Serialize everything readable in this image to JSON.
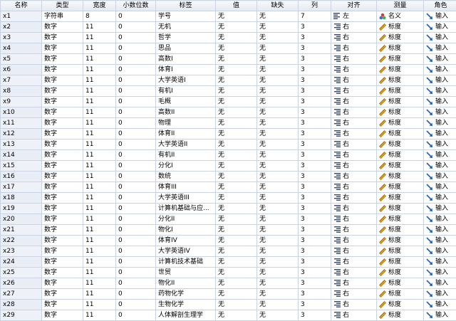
{
  "columns": [
    "名称",
    "类型",
    "宽度",
    "小数位数",
    "标签",
    "值",
    "缺失",
    "列",
    "对齐",
    "测量",
    "角色"
  ],
  "rows": [
    {
      "name": "x1",
      "type": "字符串",
      "width": "8",
      "decimals": "0",
      "label": "学号",
      "values": "无",
      "missing": "无",
      "columns": "7",
      "align": "左",
      "measure": "名义",
      "role": "输入",
      "align_icon": "align-left-icon",
      "measure_icon": "nominal-icon",
      "role_icon": "input-arrow-icon"
    },
    {
      "name": "x2",
      "type": "数字",
      "width": "11",
      "decimals": "0",
      "label": "无机",
      "values": "无",
      "missing": "无",
      "columns": "3",
      "align": "右",
      "measure": "标度",
      "role": "输入",
      "align_icon": "align-right-icon",
      "measure_icon": "ruler-icon",
      "role_icon": "input-arrow-icon"
    },
    {
      "name": "x3",
      "type": "数字",
      "width": "11",
      "decimals": "0",
      "label": "哲学",
      "values": "无",
      "missing": "无",
      "columns": "3",
      "align": "右",
      "measure": "标度",
      "role": "输入",
      "align_icon": "align-right-icon",
      "measure_icon": "ruler-icon",
      "role_icon": "input-arrow-icon"
    },
    {
      "name": "x4",
      "type": "数字",
      "width": "11",
      "decimals": "0",
      "label": "思品",
      "values": "无",
      "missing": "无",
      "columns": "3",
      "align": "右",
      "measure": "标度",
      "role": "输入",
      "align_icon": "align-right-icon",
      "measure_icon": "ruler-icon",
      "role_icon": "input-arrow-icon"
    },
    {
      "name": "x5",
      "type": "数字",
      "width": "11",
      "decimals": "0",
      "label": "高数I",
      "values": "无",
      "missing": "无",
      "columns": "3",
      "align": "右",
      "measure": "标度",
      "role": "输入",
      "align_icon": "align-right-icon",
      "measure_icon": "ruler-icon",
      "role_icon": "input-arrow-icon"
    },
    {
      "name": "x6",
      "type": "数字",
      "width": "11",
      "decimals": "0",
      "label": "体育I",
      "values": "无",
      "missing": "无",
      "columns": "3",
      "align": "右",
      "measure": "标度",
      "role": "输入",
      "align_icon": "align-right-icon",
      "measure_icon": "ruler-icon",
      "role_icon": "input-arrow-icon"
    },
    {
      "name": "x7",
      "type": "数字",
      "width": "11",
      "decimals": "0",
      "label": "大学英语I",
      "values": "无",
      "missing": "无",
      "columns": "3",
      "align": "右",
      "measure": "标度",
      "role": "输入",
      "align_icon": "align-right-icon",
      "measure_icon": "ruler-icon",
      "role_icon": "input-arrow-icon"
    },
    {
      "name": "x8",
      "type": "数字",
      "width": "11",
      "decimals": "0",
      "label": "有机I",
      "values": "无",
      "missing": "无",
      "columns": "3",
      "align": "右",
      "measure": "标度",
      "role": "输入",
      "align_icon": "align-right-icon",
      "measure_icon": "ruler-icon",
      "role_icon": "input-arrow-icon"
    },
    {
      "name": "x9",
      "type": "数字",
      "width": "11",
      "decimals": "0",
      "label": "毛概",
      "values": "无",
      "missing": "无",
      "columns": "3",
      "align": "右",
      "measure": "标度",
      "role": "输入",
      "align_icon": "align-right-icon",
      "measure_icon": "ruler-icon",
      "role_icon": "input-arrow-icon"
    },
    {
      "name": "x10",
      "type": "数字",
      "width": "11",
      "decimals": "0",
      "label": "高数II",
      "values": "无",
      "missing": "无",
      "columns": "3",
      "align": "右",
      "measure": "标度",
      "role": "输入",
      "align_icon": "align-right-icon",
      "measure_icon": "ruler-icon",
      "role_icon": "input-arrow-icon"
    },
    {
      "name": "x11",
      "type": "数字",
      "width": "11",
      "decimals": "0",
      "label": "物理",
      "values": "无",
      "missing": "无",
      "columns": "3",
      "align": "右",
      "measure": "标度",
      "role": "输入",
      "align_icon": "align-right-icon",
      "measure_icon": "ruler-icon",
      "role_icon": "input-arrow-icon"
    },
    {
      "name": "x12",
      "type": "数字",
      "width": "11",
      "decimals": "0",
      "label": "体育II",
      "values": "无",
      "missing": "无",
      "columns": "3",
      "align": "右",
      "measure": "标度",
      "role": "输入",
      "align_icon": "align-right-icon",
      "measure_icon": "ruler-icon",
      "role_icon": "input-arrow-icon"
    },
    {
      "name": "x13",
      "type": "数字",
      "width": "11",
      "decimals": "0",
      "label": "大学英语II",
      "values": "无",
      "missing": "无",
      "columns": "3",
      "align": "右",
      "measure": "标度",
      "role": "输入",
      "align_icon": "align-right-icon",
      "measure_icon": "ruler-icon",
      "role_icon": "input-arrow-icon"
    },
    {
      "name": "x14",
      "type": "数字",
      "width": "11",
      "decimals": "0",
      "label": "有机II",
      "values": "无",
      "missing": "无",
      "columns": "3",
      "align": "右",
      "measure": "标度",
      "role": "输入",
      "align_icon": "align-right-icon",
      "measure_icon": "ruler-icon",
      "role_icon": "input-arrow-icon"
    },
    {
      "name": "x15",
      "type": "数字",
      "width": "11",
      "decimals": "0",
      "label": "分化I",
      "values": "无",
      "missing": "无",
      "columns": "3",
      "align": "右",
      "measure": "标度",
      "role": "输入",
      "align_icon": "align-right-icon",
      "measure_icon": "ruler-icon",
      "role_icon": "input-arrow-icon"
    },
    {
      "name": "x16",
      "type": "数字",
      "width": "11",
      "decimals": "0",
      "label": "数统",
      "values": "无",
      "missing": "无",
      "columns": "3",
      "align": "右",
      "measure": "标度",
      "role": "输入",
      "align_icon": "align-right-icon",
      "measure_icon": "ruler-icon",
      "role_icon": "input-arrow-icon"
    },
    {
      "name": "x17",
      "type": "数字",
      "width": "11",
      "decimals": "0",
      "label": "体育III",
      "values": "无",
      "missing": "无",
      "columns": "3",
      "align": "右",
      "measure": "标度",
      "role": "输入",
      "align_icon": "align-right-icon",
      "measure_icon": "ruler-icon",
      "role_icon": "input-arrow-icon"
    },
    {
      "name": "x18",
      "type": "数字",
      "width": "11",
      "decimals": "0",
      "label": "大学英语III",
      "values": "无",
      "missing": "无",
      "columns": "3",
      "align": "右",
      "measure": "标度",
      "role": "输入",
      "align_icon": "align-right-icon",
      "measure_icon": "ruler-icon",
      "role_icon": "input-arrow-icon"
    },
    {
      "name": "x19",
      "type": "数字",
      "width": "11",
      "decimals": "0",
      "label": "计算机基础与应...",
      "values": "无",
      "missing": "无",
      "columns": "3",
      "align": "右",
      "measure": "标度",
      "role": "输入",
      "align_icon": "align-right-icon",
      "measure_icon": "ruler-icon",
      "role_icon": "input-arrow-icon"
    },
    {
      "name": "x20",
      "type": "数字",
      "width": "11",
      "decimals": "0",
      "label": "分化II",
      "values": "无",
      "missing": "无",
      "columns": "3",
      "align": "右",
      "measure": "标度",
      "role": "输入",
      "align_icon": "align-right-icon",
      "measure_icon": "ruler-icon",
      "role_icon": "input-arrow-icon"
    },
    {
      "name": "x21",
      "type": "数字",
      "width": "11",
      "decimals": "0",
      "label": "物化I",
      "values": "无",
      "missing": "无",
      "columns": "3",
      "align": "右",
      "measure": "标度",
      "role": "输入",
      "align_icon": "align-right-icon",
      "measure_icon": "ruler-icon",
      "role_icon": "input-arrow-icon"
    },
    {
      "name": "x22",
      "type": "数字",
      "width": "11",
      "decimals": "0",
      "label": "体育IV",
      "values": "无",
      "missing": "无",
      "columns": "3",
      "align": "右",
      "measure": "标度",
      "role": "输入",
      "align_icon": "align-right-icon",
      "measure_icon": "ruler-icon",
      "role_icon": "input-arrow-icon"
    },
    {
      "name": "x23",
      "type": "数字",
      "width": "11",
      "decimals": "0",
      "label": "大学英语IV",
      "values": "无",
      "missing": "无",
      "columns": "3",
      "align": "右",
      "measure": "标度",
      "role": "输入",
      "align_icon": "align-right-icon",
      "measure_icon": "ruler-icon",
      "role_icon": "input-arrow-icon"
    },
    {
      "name": "x24",
      "type": "数字",
      "width": "11",
      "decimals": "0",
      "label": "计算机技术基础",
      "values": "无",
      "missing": "无",
      "columns": "3",
      "align": "右",
      "measure": "标度",
      "role": "输入",
      "align_icon": "align-right-icon",
      "measure_icon": "ruler-icon",
      "role_icon": "input-arrow-icon"
    },
    {
      "name": "x25",
      "type": "数字",
      "width": "11",
      "decimals": "0",
      "label": "世贸",
      "values": "无",
      "missing": "无",
      "columns": "3",
      "align": "右",
      "measure": "标度",
      "role": "输入",
      "align_icon": "align-right-icon",
      "measure_icon": "ruler-icon",
      "role_icon": "input-arrow-icon"
    },
    {
      "name": "x26",
      "type": "数字",
      "width": "11",
      "decimals": "0",
      "label": "物化II",
      "values": "无",
      "missing": "无",
      "columns": "3",
      "align": "右",
      "measure": "标度",
      "role": "输入",
      "align_icon": "align-right-icon",
      "measure_icon": "ruler-icon",
      "role_icon": "input-arrow-icon"
    },
    {
      "name": "x27",
      "type": "数字",
      "width": "11",
      "decimals": "0",
      "label": "药物化学",
      "values": "无",
      "missing": "无",
      "columns": "3",
      "align": "右",
      "measure": "标度",
      "role": "输入",
      "align_icon": "align-right-icon",
      "measure_icon": "ruler-icon",
      "role_icon": "input-arrow-icon"
    },
    {
      "name": "x28",
      "type": "数字",
      "width": "11",
      "decimals": "0",
      "label": "生物化学",
      "values": "无",
      "missing": "无",
      "columns": "3",
      "align": "右",
      "measure": "标度",
      "role": "输入",
      "align_icon": "align-right-icon",
      "measure_icon": "ruler-icon",
      "role_icon": "input-arrow-icon"
    },
    {
      "name": "x29",
      "type": "数字",
      "width": "11",
      "decimals": "0",
      "label": "人体解剖生理学",
      "values": "无",
      "missing": "无",
      "columns": "3",
      "align": "右",
      "measure": "标度",
      "role": "输入",
      "align_icon": "align-right-icon",
      "measure_icon": "ruler-icon",
      "role_icon": "input-arrow-icon"
    }
  ],
  "colors": {
    "grid_line": "#c9d3e2",
    "header_bg": "#e3e9f2",
    "ruler": "#e0a020",
    "input_arrow": "#1f5fbf"
  }
}
